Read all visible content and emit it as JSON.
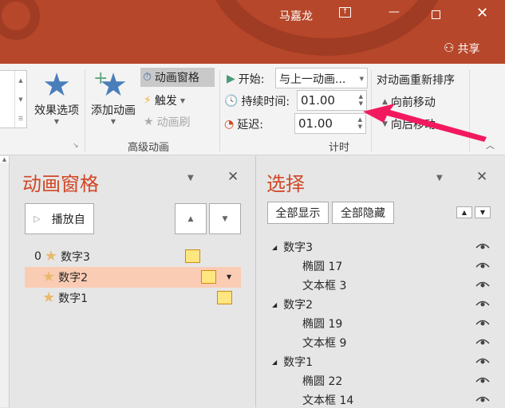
{
  "titlebar": {
    "user": "马嘉龙",
    "share": "共享",
    "bg": "#b7472a"
  },
  "ribbon": {
    "effect_options": "效果选项",
    "add_animation": "添加动画",
    "animation_pane": "动画窗格",
    "trigger": "触发",
    "animation_painter": "动画刷",
    "advanced_group": "高级动画",
    "start_label": "开始:",
    "start_value": "与上一动画...",
    "duration_label": "持续时间:",
    "duration_value": "01.00",
    "delay_label": "延迟:",
    "delay_value": "01.00",
    "timing_group": "计时",
    "reorder_title": "对动画重新排序",
    "move_earlier": "向前移动",
    "move_later": "向后移动"
  },
  "animation_pane": {
    "title": "动画窗格",
    "play_from": "播放自",
    "items": [
      {
        "index": "0",
        "label": "数字3"
      },
      {
        "index": "",
        "label": "数字2"
      },
      {
        "index": "",
        "label": "数字1"
      }
    ]
  },
  "selection_pane": {
    "title": "选择",
    "show_all": "全部显示",
    "hide_all": "全部隐藏",
    "items": [
      {
        "label": "数字3",
        "level": 0
      },
      {
        "label": "椭圆 17",
        "level": 1
      },
      {
        "label": "文本框 3",
        "level": 1
      },
      {
        "label": "数字2",
        "level": 0
      },
      {
        "label": "椭圆 19",
        "level": 1
      },
      {
        "label": "文本框 9",
        "level": 1
      },
      {
        "label": "数字1",
        "level": 0
      },
      {
        "label": "椭圆 22",
        "level": 1
      },
      {
        "label": "文本框 14",
        "level": 1
      }
    ]
  }
}
